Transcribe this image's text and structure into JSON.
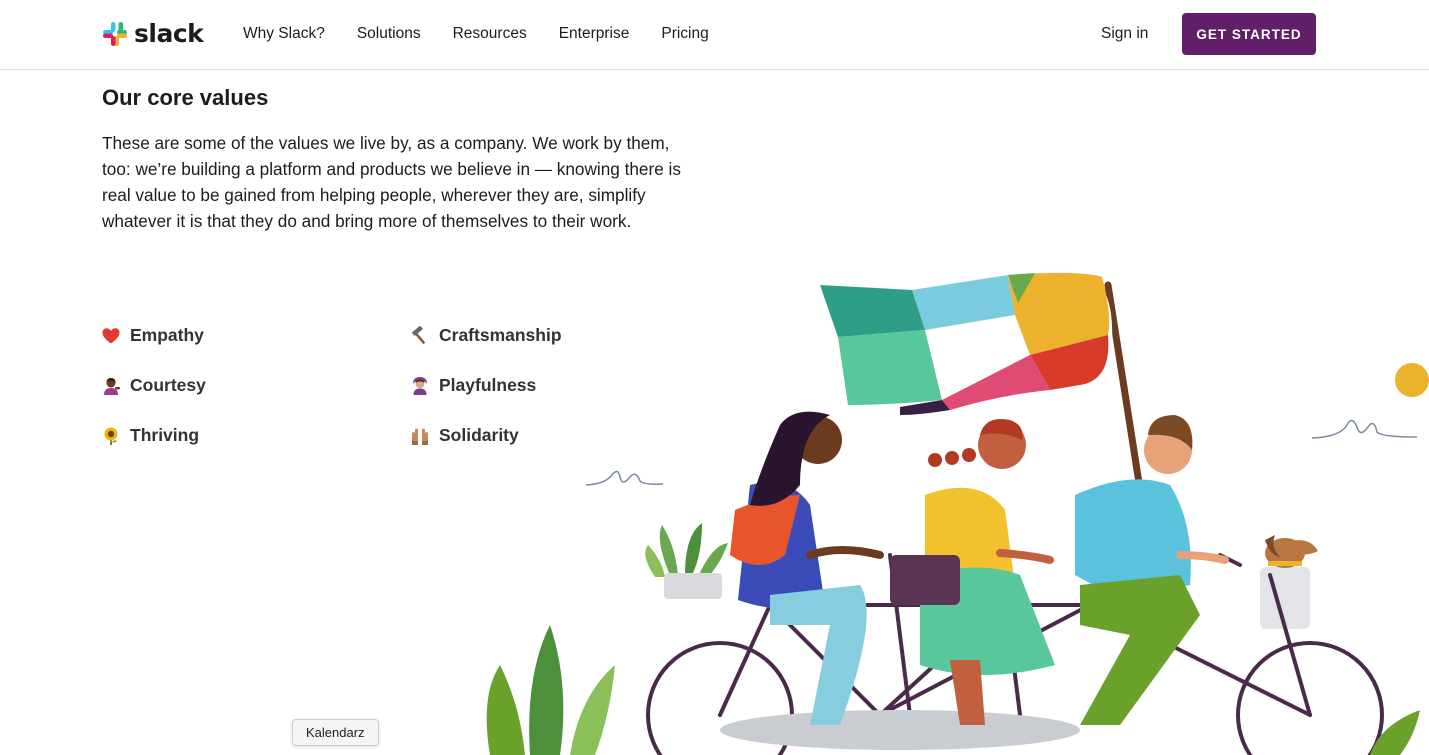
{
  "header": {
    "logo_text": "slack",
    "nav": [
      "Why Slack?",
      "Solutions",
      "Resources",
      "Enterprise",
      "Pricing"
    ],
    "signin_label": "Sign in",
    "cta_label": "GET STARTED",
    "brand_colors": {
      "aubergine": "#611f69",
      "blue": "#36c5f0",
      "green": "#2eb67d",
      "yellow": "#ecb22e",
      "red": "#e01e5a"
    }
  },
  "main": {
    "heading": "Our core values",
    "intro": "These are some of the values we live by, as a company. We work by them, too: we’re building a platform and products we believe in — knowing there is real value to be gained from helping people, wherever they are, simplify whatever it is that they do and bring more of themselves to their work.",
    "values": [
      {
        "label": "Empathy",
        "icon": "heart-icon"
      },
      {
        "label": "Craftsmanship",
        "icon": "hammer-icon"
      },
      {
        "label": "Courtesy",
        "icon": "person-tipping-hand-icon"
      },
      {
        "label": "Playfulness",
        "icon": "person-gesturing-ok-icon"
      },
      {
        "label": "Thriving",
        "icon": "sunflower-icon"
      },
      {
        "label": "Solidarity",
        "icon": "raised-hands-icon"
      }
    ]
  },
  "tooltip": {
    "text": "Kalendarz"
  }
}
